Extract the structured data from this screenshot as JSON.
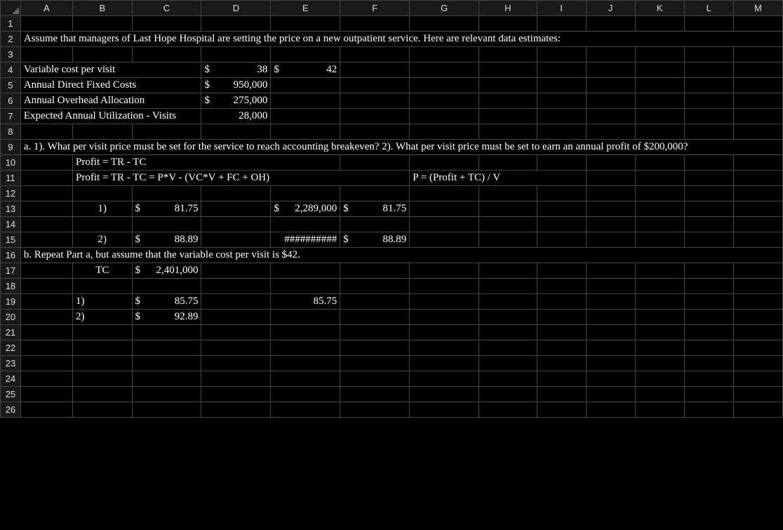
{
  "columns": [
    "A",
    "B",
    "C",
    "D",
    "E",
    "F",
    "G",
    "H",
    "I",
    "J",
    "K",
    "L",
    "M"
  ],
  "rows": [
    "1",
    "2",
    "3",
    "4",
    "5",
    "6",
    "7",
    "8",
    "9",
    "10",
    "11",
    "12",
    "13",
    "14",
    "15",
    "16",
    "17",
    "18",
    "19",
    "20",
    "21",
    "22",
    "23",
    "24",
    "25",
    "26"
  ],
  "r2": {
    "text": "Assume that managers of Last Hope Hospital are setting the price on a new outpatient service. Here are relevant data estimates:"
  },
  "r4": {
    "label": "Variable cost per visit",
    "d_sym": "$",
    "d_val": "38",
    "e_sym": "$",
    "e_val": "42"
  },
  "r5": {
    "label": "Annual Direct Fixed Costs",
    "d_sym": "$",
    "d_val": "950,000"
  },
  "r6": {
    "label": "Annual Overhead Allocation",
    "d_sym": "$",
    "d_val": "275,000"
  },
  "r7": {
    "label": "Expected Annual Utilization - Visits",
    "d_val": "28,000"
  },
  "r9": {
    "text": "a.   1). What per visit price must be set for the service to reach accounting breakeven? 2). What per visit price must be set to earn an annual profit of $200,000?"
  },
  "r10": {
    "formula": "Profit = TR - TC"
  },
  "r11": {
    "formula": "Profit = TR - TC = P*V - (VC*V + FC + OH)",
    "g": "P = (Profit + TC) / V"
  },
  "r13": {
    "b": "1)",
    "c_sym": "$",
    "c_val": "81.75",
    "e_sym": "$",
    "e_val": "2,289,000",
    "f_sym": "$",
    "f_val": "81.75"
  },
  "r15": {
    "b": "2)",
    "c_sym": "$",
    "c_val": "88.89",
    "e": "##########",
    "f_sym": "$",
    "f_val": "88.89"
  },
  "r16": {
    "text": "b.   Repeat Part a, but assume that the variable cost per visit is $42."
  },
  "r17": {
    "b": "TC",
    "c_sym": "$",
    "c_val": "2,401,000"
  },
  "r19": {
    "b": "1)",
    "c_sym": "$",
    "c_val": "85.75",
    "e": "85.75"
  },
  "r20": {
    "b": "2)",
    "c_sym": "$",
    "c_val": "92.89"
  }
}
